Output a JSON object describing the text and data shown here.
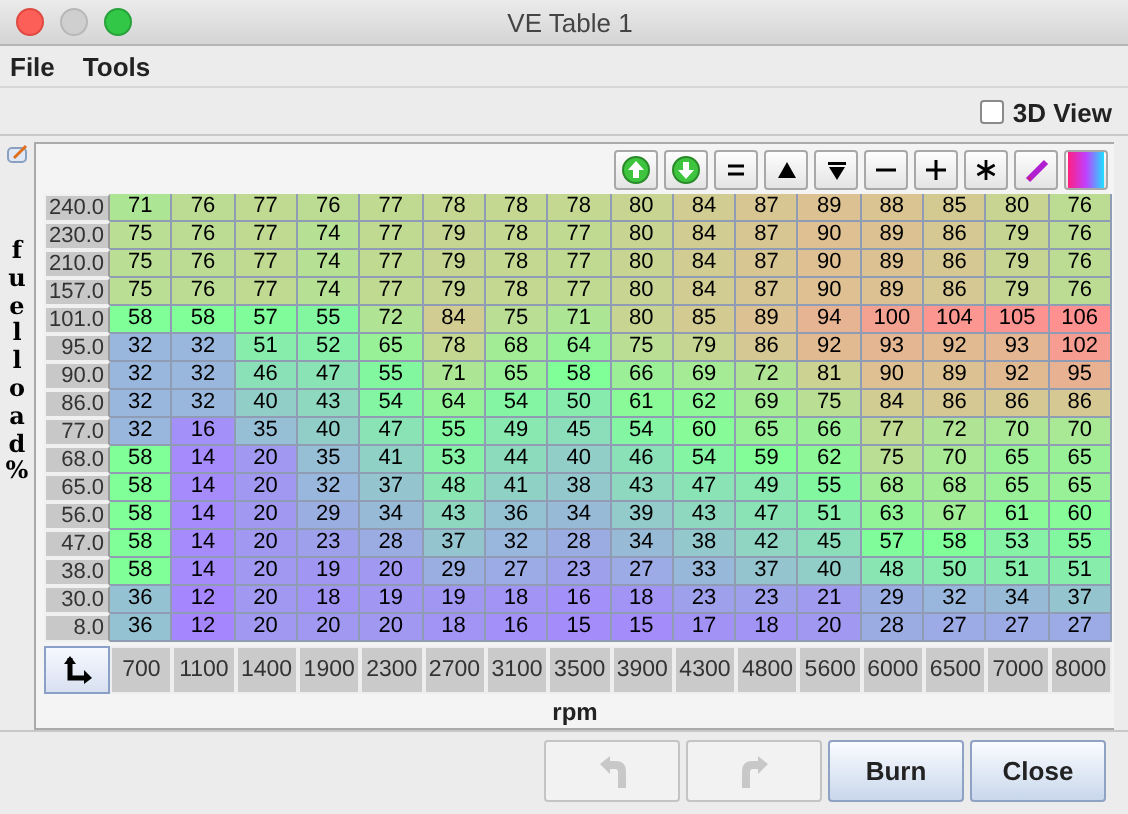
{
  "window": {
    "title": "VE Table 1"
  },
  "menu": [
    "File",
    "Tools"
  ],
  "view_3d": {
    "label": "3D View",
    "checked": false
  },
  "table": {
    "y_axis_label": "fuel load %",
    "x_axis_label": "rpm",
    "columns": [
      "700",
      "1100",
      "1400",
      "1900",
      "2300",
      "2700",
      "3100",
      "3500",
      "3900",
      "4300",
      "4800",
      "5600",
      "6000",
      "6500",
      "7000",
      "8000"
    ],
    "rows": [
      {
        "load": "240.0",
        "values": [
          "71",
          "76",
          "77",
          "76",
          "77",
          "78",
          "78",
          "78",
          "80",
          "84",
          "87",
          "89",
          "88",
          "85",
          "80",
          "76"
        ]
      },
      {
        "load": "230.0",
        "values": [
          "75",
          "76",
          "77",
          "74",
          "77",
          "79",
          "78",
          "77",
          "80",
          "84",
          "87",
          "90",
          "89",
          "86",
          "79",
          "76"
        ]
      },
      {
        "load": "210.0",
        "values": [
          "75",
          "76",
          "77",
          "74",
          "77",
          "79",
          "78",
          "77",
          "80",
          "84",
          "87",
          "90",
          "89",
          "86",
          "79",
          "76"
        ]
      },
      {
        "load": "157.0",
        "values": [
          "75",
          "76",
          "77",
          "74",
          "77",
          "79",
          "78",
          "77",
          "80",
          "84",
          "87",
          "90",
          "89",
          "86",
          "79",
          "76"
        ]
      },
      {
        "load": "101.0",
        "values": [
          "58",
          "58",
          "57",
          "55",
          "72",
          "84",
          "75",
          "71",
          "80",
          "85",
          "89",
          "94",
          "100",
          "104",
          "105",
          "106"
        ]
      },
      {
        "load": "95.0",
        "values": [
          "32",
          "32",
          "51",
          "52",
          "65",
          "78",
          "68",
          "64",
          "75",
          "79",
          "86",
          "92",
          "93",
          "92",
          "93",
          "102"
        ]
      },
      {
        "load": "90.0",
        "values": [
          "32",
          "32",
          "46",
          "47",
          "55",
          "71",
          "65",
          "58",
          "66",
          "69",
          "72",
          "81",
          "90",
          "89",
          "92",
          "95"
        ]
      },
      {
        "load": "86.0",
        "values": [
          "32",
          "32",
          "40",
          "43",
          "54",
          "64",
          "54",
          "50",
          "61",
          "62",
          "69",
          "75",
          "84",
          "86",
          "86",
          "86"
        ]
      },
      {
        "load": "77.0",
        "values": [
          "32",
          "16",
          "35",
          "40",
          "47",
          "55",
          "49",
          "45",
          "54",
          "60",
          "65",
          "66",
          "77",
          "72",
          "70",
          "70"
        ]
      },
      {
        "load": "68.0",
        "values": [
          "58",
          "14",
          "20",
          "35",
          "41",
          "53",
          "44",
          "40",
          "46",
          "54",
          "59",
          "62",
          "75",
          "70",
          "65",
          "65"
        ]
      },
      {
        "load": "65.0",
        "values": [
          "58",
          "14",
          "20",
          "32",
          "37",
          "48",
          "41",
          "38",
          "43",
          "47",
          "49",
          "55",
          "68",
          "68",
          "65",
          "65"
        ]
      },
      {
        "load": "56.0",
        "values": [
          "58",
          "14",
          "20",
          "29",
          "34",
          "43",
          "36",
          "34",
          "39",
          "43",
          "47",
          "51",
          "63",
          "67",
          "61",
          "60"
        ]
      },
      {
        "load": "47.0",
        "values": [
          "58",
          "14",
          "20",
          "23",
          "28",
          "37",
          "32",
          "28",
          "34",
          "38",
          "42",
          "45",
          "57",
          "58",
          "53",
          "55"
        ]
      },
      {
        "load": "38.0",
        "values": [
          "58",
          "14",
          "20",
          "19",
          "20",
          "29",
          "27",
          "23",
          "27",
          "33",
          "37",
          "40",
          "48",
          "50",
          "51",
          "51"
        ]
      },
      {
        "load": "30.0",
        "values": [
          "36",
          "12",
          "20",
          "18",
          "19",
          "19",
          "18",
          "16",
          "18",
          "23",
          "23",
          "21",
          "29",
          "32",
          "34",
          "37"
        ]
      },
      {
        "load": "8.0",
        "values": [
          "36",
          "12",
          "20",
          "20",
          "20",
          "18",
          "16",
          "15",
          "15",
          "17",
          "18",
          "20",
          "28",
          "27",
          "27",
          "27"
        ]
      }
    ]
  },
  "buttons": [
    {
      "kind": "undo",
      "disabled": true
    },
    {
      "kind": "redo",
      "disabled": true
    },
    {
      "kind": "text",
      "label": "Burn",
      "disabled": false
    },
    {
      "kind": "text",
      "label": "Close",
      "disabled": false
    }
  ]
}
